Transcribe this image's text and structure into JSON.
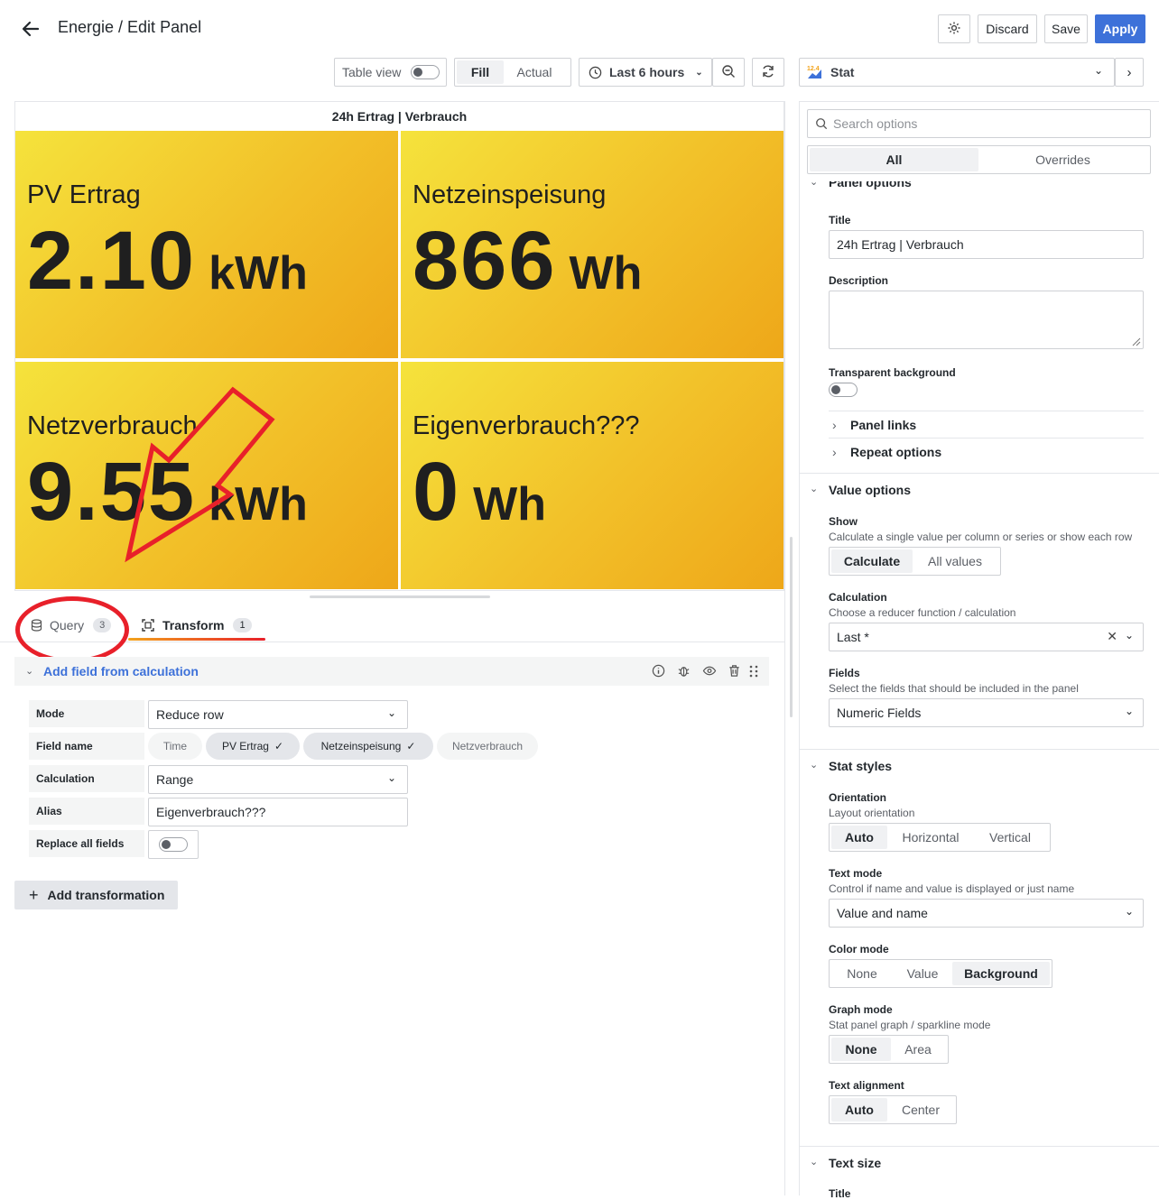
{
  "header": {
    "title": "Energie / Edit Panel",
    "discard": "Discard",
    "save": "Save",
    "apply": "Apply"
  },
  "toolbar": {
    "table_view": "Table view",
    "fill": "Fill",
    "actual": "Actual",
    "time_range": "Last 6 hours",
    "visualization": "Stat"
  },
  "panel": {
    "title": "24h Ertrag | Verbrauch",
    "stats": [
      {
        "name": "PV Ertrag",
        "value": "2.10",
        "unit": "kWh"
      },
      {
        "name": "Netzeinspeisung",
        "value": "866",
        "unit": "Wh"
      },
      {
        "name": "Netzverbrauch",
        "value": "9.55",
        "unit": "kWh"
      },
      {
        "name": "Eigenverbrauch???",
        "value": "0",
        "unit": "Wh"
      }
    ],
    "colors": {
      "bg_start": "#f5e33c",
      "bg_end": "#eea719",
      "annotation": "#e8202a"
    }
  },
  "tabs": [
    {
      "label": "Query",
      "count": "3"
    },
    {
      "label": "Transform",
      "count": "1"
    }
  ],
  "transformation": {
    "title": "Add field from calculation",
    "rows": {
      "mode_label": "Mode",
      "mode_value": "Reduce row",
      "field_name_label": "Field name",
      "fields": [
        "Time",
        "PV Ertrag",
        "Netzeinspeisung",
        "Netzverbrauch"
      ],
      "calculation_label": "Calculation",
      "calculation_value": "Range",
      "alias_label": "Alias",
      "alias_value": "Eigenverbrauch???",
      "replace_label": "Replace all fields"
    },
    "add_button": "Add transformation"
  },
  "options": {
    "search_placeholder": "Search options",
    "tab_all": "All",
    "tab_overrides": "Overrides",
    "panel_options": {
      "heading": "Panel options",
      "title_label": "Title",
      "title_value": "24h Ertrag | Verbrauch",
      "description_label": "Description",
      "transparent_label": "Transparent background",
      "panel_links": "Panel links",
      "repeat_options": "Repeat options"
    },
    "value_options": {
      "heading": "Value options",
      "show_label": "Show",
      "show_desc": "Calculate a single value per column or series or show each row",
      "show_opts": [
        "Calculate",
        "All values"
      ],
      "calc_label": "Calculation",
      "calc_desc": "Choose a reducer function / calculation",
      "calc_value": "Last *",
      "fields_label": "Fields",
      "fields_desc": "Select the fields that should be included in the panel",
      "fields_value": "Numeric Fields"
    },
    "stat_styles": {
      "heading": "Stat styles",
      "orientation_label": "Orientation",
      "orientation_desc": "Layout orientation",
      "orientation_opts": [
        "Auto",
        "Horizontal",
        "Vertical"
      ],
      "text_mode_label": "Text mode",
      "text_mode_desc": "Control if name and value is displayed or just name",
      "text_mode_value": "Value and name",
      "color_mode_label": "Color mode",
      "color_mode_opts": [
        "None",
        "Value",
        "Background"
      ],
      "graph_mode_label": "Graph mode",
      "graph_mode_desc": "Stat panel graph / sparkline mode",
      "graph_mode_opts": [
        "None",
        "Area"
      ],
      "text_align_label": "Text alignment",
      "text_align_opts": [
        "Auto",
        "Center"
      ]
    },
    "text_size": {
      "heading": "Text size",
      "title_label": "Title"
    }
  }
}
